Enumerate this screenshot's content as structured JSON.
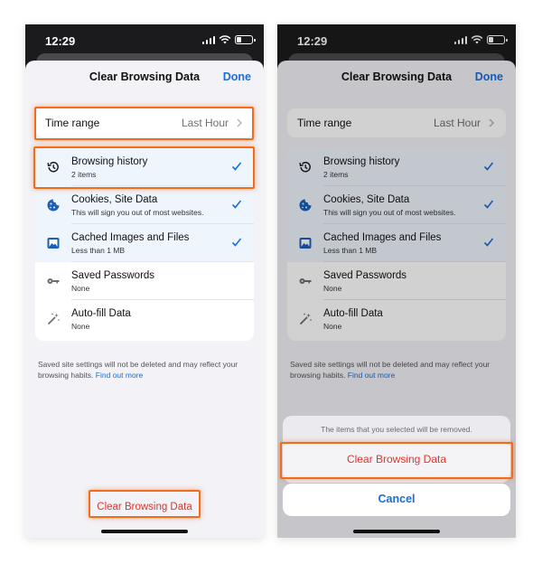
{
  "status_bar": {
    "time": "12:29"
  },
  "sheet": {
    "title": "Clear Browsing Data",
    "done_label": "Done",
    "time_range": {
      "label": "Time range",
      "value": "Last Hour"
    },
    "items": [
      {
        "icon": "history-icon",
        "title": "Browsing history",
        "subtitle": "2 items",
        "checked": true
      },
      {
        "icon": "cookie-icon",
        "title": "Cookies, Site Data",
        "subtitle": "This will sign you out of most websites.",
        "checked": true
      },
      {
        "icon": "image-icon",
        "title": "Cached Images and Files",
        "subtitle": "Less than 1 MB",
        "checked": true
      },
      {
        "icon": "key-icon",
        "title": "Saved Passwords",
        "subtitle": "None",
        "checked": false
      },
      {
        "icon": "magic-wand-icon",
        "title": "Auto-fill Data",
        "subtitle": "None",
        "checked": false
      }
    ],
    "footnote": "Saved site settings will not be deleted and may reflect your browsing habits.",
    "footnote_link": "Find out more",
    "clear_button_label": "Clear Browsing Data"
  },
  "confirmation": {
    "message": "The items that you selected will be removed.",
    "confirm_label": "Clear Browsing Data",
    "cancel_label": "Cancel"
  },
  "colors": {
    "accent": "#1a6ed8",
    "destructive": "#e0352b",
    "highlight": "#f36c1c"
  }
}
